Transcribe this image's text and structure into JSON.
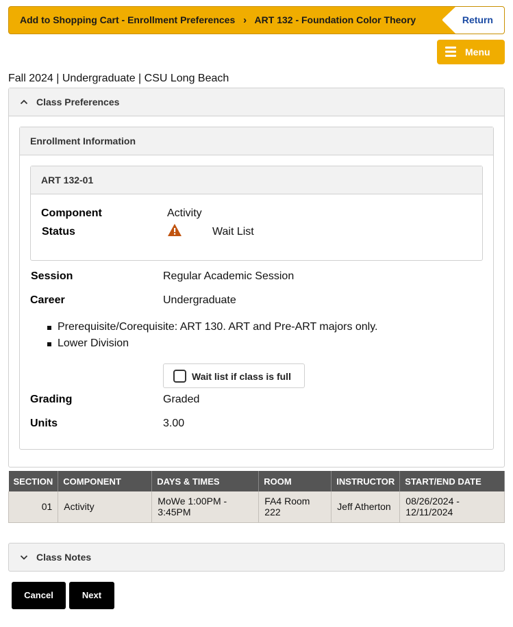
{
  "header": {
    "breadcrumb_1": "Add to Shopping Cart - Enrollment Preferences",
    "breadcrumb_2": "ART  132 - Foundation Color Theory",
    "return_label": "Return",
    "menu_label": "Menu"
  },
  "term_info": "Fall 2024 | Undergraduate | CSU Long Beach",
  "class_preferences": {
    "title": "Class Preferences",
    "enrollment_title": "Enrollment Information",
    "class_id": "ART  132-01",
    "component_label": "Component",
    "component_value": "Activity",
    "status_label": "Status",
    "status_value": "Wait List",
    "session_label": "Session",
    "session_value": "Regular Academic Session",
    "career_label": "Career",
    "career_value": "Undergraduate",
    "notes": [
      "Prerequisite/Corequisite: ART 130. ART and Pre-ART majors only.",
      "Lower Division"
    ],
    "waitlist_label": "Wait list if class is full",
    "grading_label": "Grading",
    "grading_value": "Graded",
    "units_label": "Units",
    "units_value": "3.00"
  },
  "section_table": {
    "headers": [
      "SECTION",
      "COMPONENT",
      "DAYS & TIMES",
      "ROOM",
      "INSTRUCTOR",
      "START/END DATE"
    ],
    "rows": [
      {
        "section": "01",
        "component": "Activity",
        "days_times": "MoWe 1:00PM - 3:45PM",
        "room": "FA4  Room 222",
        "instructor": "Jeff Atherton",
        "dates": "08/26/2024 - 12/11/2024"
      }
    ]
  },
  "class_notes_title": "Class Notes",
  "buttons": {
    "cancel": "Cancel",
    "next": "Next"
  },
  "colors": {
    "accent": "#f0ad00",
    "warning": "#c0530f",
    "table_header": "#555555"
  }
}
